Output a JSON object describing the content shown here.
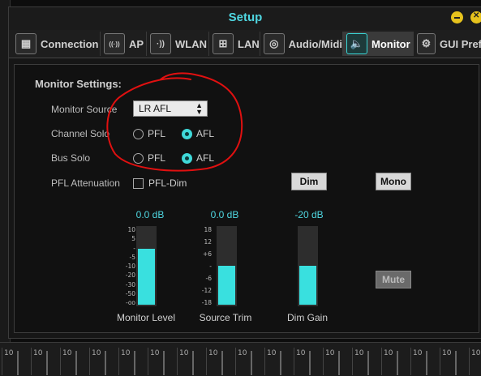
{
  "window": {
    "title": "Setup"
  },
  "tabs": [
    {
      "label": "Connection",
      "icon": "connection-icon",
      "glyph": "▦"
    },
    {
      "label": "AP",
      "icon": "antenna-icon",
      "glyph": "((·))"
    },
    {
      "label": "WLAN",
      "icon": "wifi-icon",
      "glyph": "·))"
    },
    {
      "label": "LAN",
      "icon": "ethernet-icon",
      "glyph": "⊞"
    },
    {
      "label": "Audio/Midi",
      "icon": "audio-midi-icon",
      "glyph": "◎"
    },
    {
      "label": "Monitor",
      "icon": "monitor-speaker-icon",
      "glyph": "🔈"
    },
    {
      "label": "GUI Pref",
      "icon": "gear-icon",
      "glyph": "⚙"
    }
  ],
  "monitor": {
    "heading": "Monitor Settings:",
    "source_label": "Monitor Source",
    "source_value": "LR AFL",
    "channel_solo_label": "Channel Solo",
    "bus_solo_label": "Bus Solo",
    "pfl_label": "PFL",
    "afl_label": "AFL",
    "channel_solo_selected": "AFL",
    "bus_solo_selected": "AFL",
    "pfl_att_label": "PFL Attenuation",
    "pfl_dim_label": "PFL-Dim",
    "pfl_dim_checked": false,
    "dim_button": "Dim",
    "mono_button": "Mono",
    "mute_button": "Mute"
  },
  "meters": [
    {
      "name": "monitor-level",
      "value": "0.0 dB",
      "caption": "Monitor Level",
      "scale": [
        "10",
        "5",
        "-",
        "-5",
        "-10",
        "-20",
        "-30",
        "-50",
        "-oo"
      ],
      "fill_fraction": 0.73
    },
    {
      "name": "source-trim",
      "value": "0.0 dB",
      "caption": "Source Trim",
      "scale": [
        "18",
        "12",
        "+6",
        "-",
        "-6",
        "-12",
        "-18"
      ],
      "fill_fraction": 0.5
    },
    {
      "name": "dim-gain",
      "value": "-20 dB",
      "caption": "Dim Gain",
      "scale": [],
      "fill_fraction": 0.5
    }
  ],
  "background_strip": {
    "fader_label": "10"
  },
  "colors": {
    "accent": "#39e0df",
    "title": "#4fd6e0",
    "annotation": "#e01010",
    "window_button": "#e6c21d"
  }
}
